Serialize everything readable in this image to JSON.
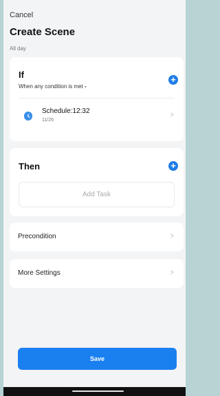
{
  "header": {
    "cancel_label": "Cancel",
    "title": "Create Scene",
    "subtitle": "All day"
  },
  "if_section": {
    "label": "If",
    "condition_mode": "When any condition is met",
    "caret": "▾",
    "add_icon": "plus-circle-icon",
    "conditions": [
      {
        "icon": "clock-icon",
        "title": "Schedule:12:32",
        "date": "11/26"
      }
    ]
  },
  "then_section": {
    "label": "Then",
    "add_icon": "plus-circle-icon",
    "add_task_label": "Add Task"
  },
  "precondition": {
    "label": "Precondition"
  },
  "more_settings": {
    "label": "More Settings"
  },
  "save_label": "Save",
  "colors": {
    "accent": "#1a80f0",
    "icon_blue": "#3b8fe8",
    "background": "#f3f4f6",
    "outer_background": "#b7d3d3"
  }
}
